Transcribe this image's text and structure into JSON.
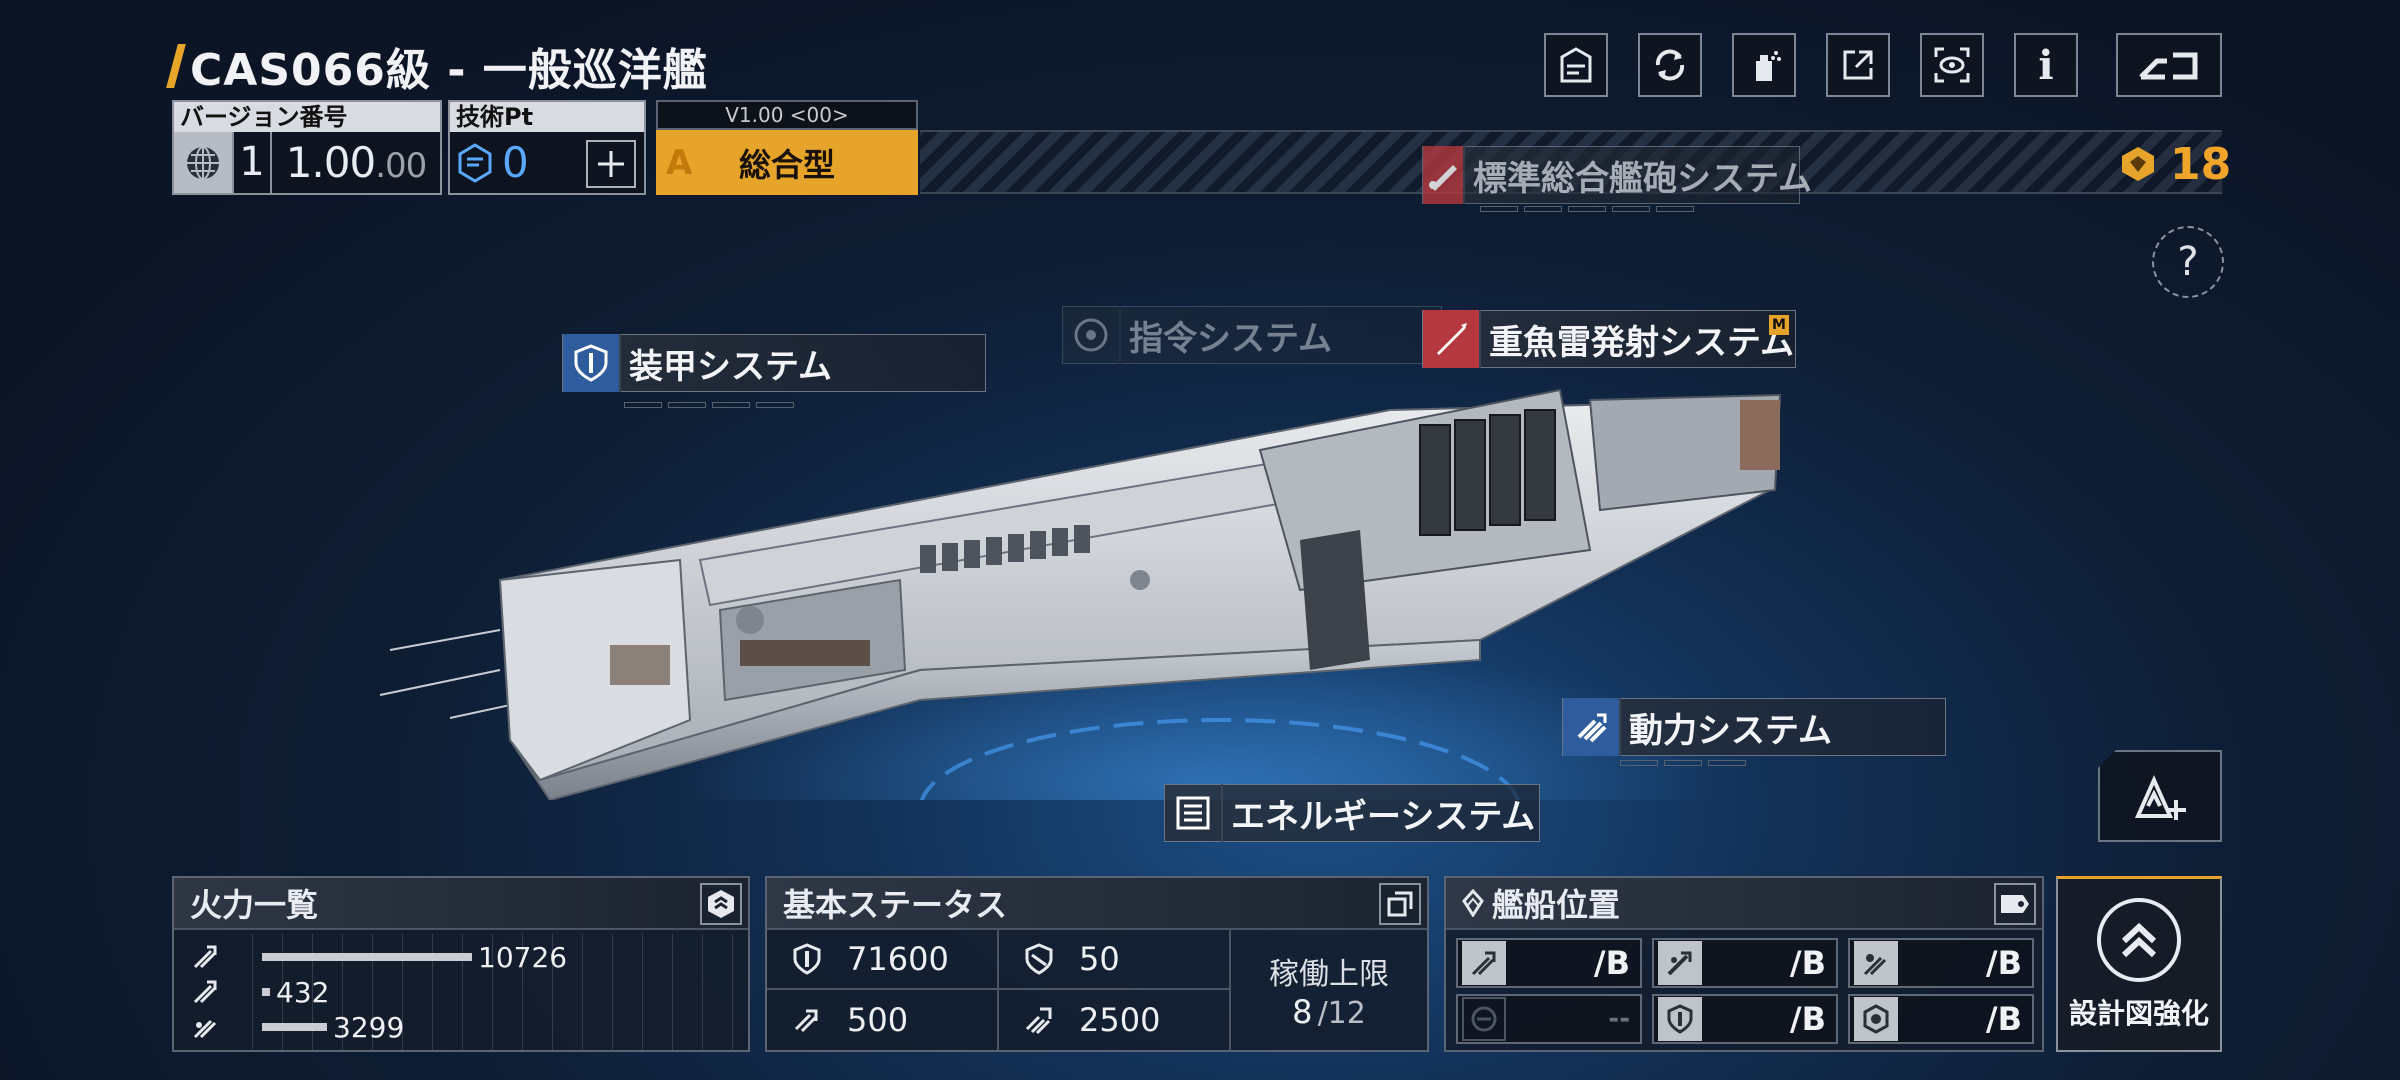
{
  "header": {
    "title": "CAS066級 - 一般巡洋艦",
    "icons": [
      "blueprint-icon",
      "refresh-icon",
      "paint-spray-icon",
      "share-icon",
      "view-icon",
      "info-icon",
      "back-icon"
    ],
    "coins": "18"
  },
  "version": {
    "header": "バージョン番号",
    "major": "1",
    "minor_main": "1.00",
    "minor_sub": ".00"
  },
  "tech": {
    "header": "技術Pt",
    "value": "0"
  },
  "type": {
    "version_tag": "V1.00 <00>",
    "grade": "A",
    "name": "総合型"
  },
  "systems": {
    "main_gun": "標準総合艦砲システム",
    "armor": "装甲システム",
    "command": "指令システム",
    "torpedo": "重魚雷発射システム",
    "torpedo_badge": "M",
    "power": "動力システム",
    "energy": "エネルギーシステム"
  },
  "firepower": {
    "title": "火力一覧",
    "rows": [
      {
        "value": "10726",
        "fraction": 1.0
      },
      {
        "value": "432",
        "fraction": 0.04
      },
      {
        "value": "3299",
        "fraction": 0.31
      }
    ]
  },
  "stats": {
    "title": "基本ステータス",
    "hp": "71600",
    "armor": "50",
    "speed": "500",
    "warp": "2500",
    "op_label": "稼働上限",
    "op_value": "8",
    "op_max": "/12"
  },
  "position": {
    "title": "艦船位置",
    "cells": [
      {
        "value": "/B"
      },
      {
        "value": "/B"
      },
      {
        "value": "/B"
      },
      {
        "value": "--"
      },
      {
        "value": "/B"
      },
      {
        "value": "/B"
      }
    ]
  },
  "upgrade": {
    "label": "設計図強化"
  },
  "colors": {
    "accent": "#e6a52a",
    "system_red": "#b4383d",
    "system_blue": "#2f5c9c",
    "tech_blue": "#5aa8ff"
  }
}
